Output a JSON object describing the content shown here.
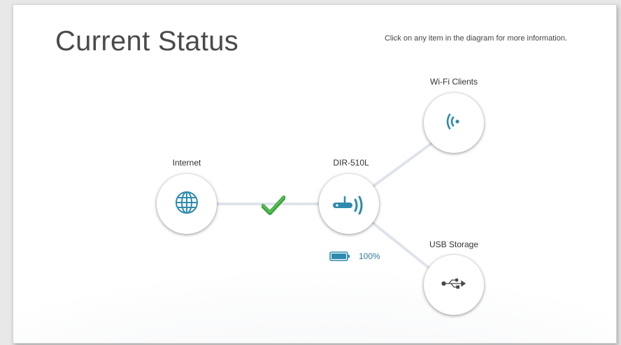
{
  "header": {
    "title": "Current Status",
    "hint": "Click on any item in the diagram for more information."
  },
  "nodes": {
    "internet": {
      "label": "Internet",
      "icon": "globe-icon"
    },
    "router": {
      "label": "DIR-510L",
      "icon": "router-icon"
    },
    "wifi_clients": {
      "label": "Wi-Fi Clients",
      "icon": "wifi-signal-icon"
    },
    "usb_storage": {
      "label": "USB Storage",
      "icon": "usb-icon"
    }
  },
  "connection": {
    "internet_status_icon": "checkmark-icon",
    "status": "connected"
  },
  "battery": {
    "percent_text": "100%",
    "level": 1.0
  },
  "colors": {
    "accent": "#2f8bad",
    "check": "#3ca23c",
    "link_line": "#dfe3ea"
  }
}
